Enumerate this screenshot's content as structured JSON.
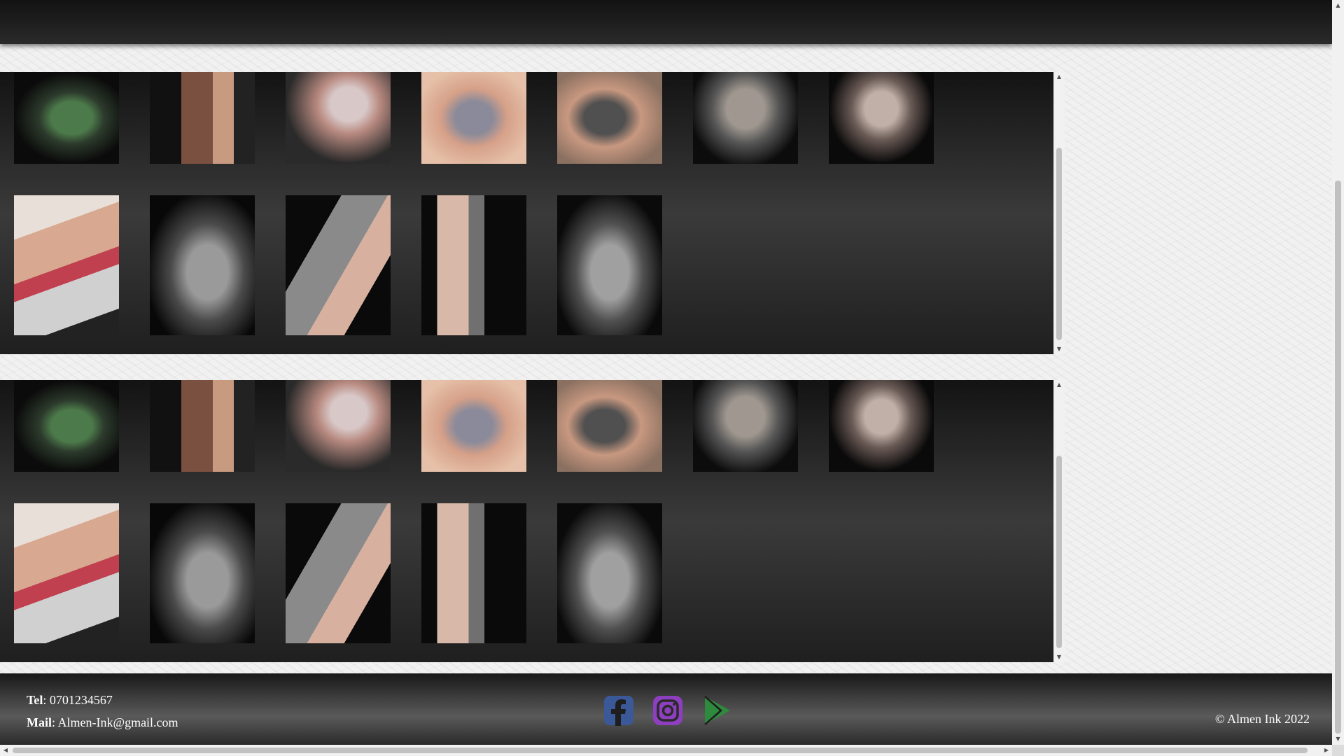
{
  "footer": {
    "tel_label": "Tel",
    "tel_value": ": 0701234567",
    "mail_label": "Mail",
    "mail_value": ": Almen-Ink@gmail.com",
    "copyright": "© Almen Ink 2022"
  },
  "social": [
    {
      "name": "facebook-icon",
      "color": "#3b5998"
    },
    {
      "name": "instagram-icon",
      "color": "#8e3fbf"
    },
    {
      "name": "google-play-icon",
      "color": "#2e8b3e"
    }
  ],
  "scroll_arrows": {
    "up": "▲",
    "down": "▼",
    "left": "◀",
    "right": "▶"
  },
  "gallery_items": [
    "tattoo-photo-green-portrait",
    "tattoo-photo-butterflies",
    "tattoo-photo-eagle",
    "tattoo-photo-chest-flower",
    "tattoo-photo-chest-sleeve",
    "tattoo-photo-woman-portrait",
    "tattoo-photo-harley-portrait",
    "tattoo-photo-red-lettering",
    "tattoo-photo-sleeve-1",
    "tattoo-photo-sleeve-2",
    "tattoo-photo-sleeve-3",
    "tattoo-photo-sleeve-4"
  ]
}
